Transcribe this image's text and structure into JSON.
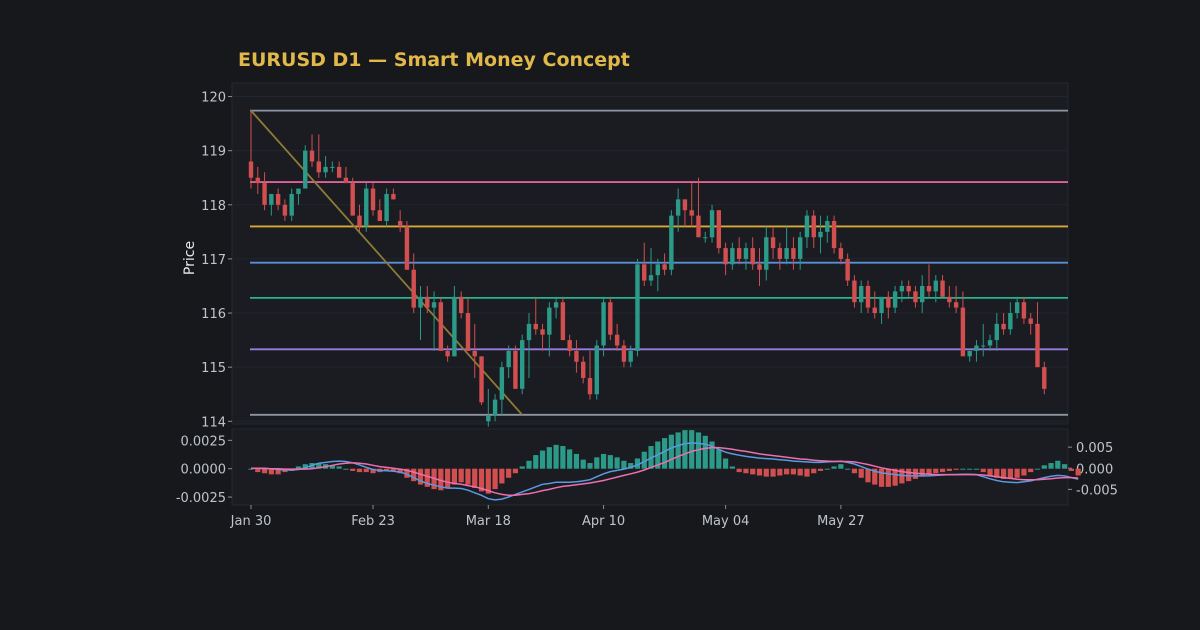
{
  "chart_data": {
    "type": "candlestick",
    "title": "EURUSD D1 — Smart Money Concept",
    "ylabel": "Price",
    "colors": {
      "background": "#17181c",
      "panel": "#1a1c22",
      "bull": "#2b9a88",
      "bear": "#d24f50",
      "macd_line": "#5a9ae0",
      "signal_line": "#ee6fae",
      "trend_line": "#8f7a36"
    },
    "price_panel": {
      "ylim": [
        113.95,
        120.25
      ],
      "yticks": [
        "114",
        "115",
        "116",
        "117",
        "118",
        "119",
        "120"
      ],
      "levels": [
        {
          "value": 119.74,
          "color": "#8e96a1"
        },
        {
          "value": 118.42,
          "color": "#e0629a"
        },
        {
          "value": 117.6,
          "color": "#d9a93a"
        },
        {
          "value": 116.93,
          "color": "#5a8fd6"
        },
        {
          "value": 116.28,
          "color": "#26b58c"
        },
        {
          "value": 115.33,
          "color": "#9a7de0"
        },
        {
          "value": 114.12,
          "color": "#8e96a1"
        }
      ],
      "trendline": {
        "from": {
          "index": 0,
          "price": 119.74
        },
        "to": {
          "index": 40,
          "price": 114.12
        }
      }
    },
    "macd_panel": {
      "left_ylim": [
        -0.0032,
        0.0035
      ],
      "left_ticks": [
        "0.0025",
        "0.0000",
        "-0.0025"
      ],
      "right_ylim": [
        -0.0087,
        0.0093
      ],
      "right_ticks": [
        "0.005",
        "0.000",
        "-0.005"
      ]
    },
    "x_ticks": [
      {
        "label": "Jan 30",
        "index": 0
      },
      {
        "label": "Feb 23",
        "index": 18
      },
      {
        "label": "Mar 18",
        "index": 35
      },
      {
        "label": "Apr 10",
        "index": 52
      },
      {
        "label": "May 04",
        "index": 70
      },
      {
        "label": "May 27",
        "index": 87
      }
    ],
    "candles": [
      [
        118.8,
        119.75,
        118.3,
        118.5
      ],
      [
        118.5,
        118.7,
        118.2,
        118.4
      ],
      [
        118.4,
        118.6,
        117.9,
        118.0
      ],
      [
        118.0,
        118.2,
        117.8,
        118.2
      ],
      [
        118.2,
        118.3,
        117.9,
        118.0
      ],
      [
        118.0,
        118.1,
        117.7,
        117.8
      ],
      [
        117.8,
        118.3,
        117.7,
        118.2
      ],
      [
        118.2,
        118.3,
        118.0,
        118.3
      ],
      [
        118.3,
        119.1,
        118.3,
        119.0
      ],
      [
        119.0,
        119.3,
        118.7,
        118.8
      ],
      [
        118.8,
        119.3,
        118.5,
        118.6
      ],
      [
        118.6,
        118.9,
        118.5,
        118.7
      ],
      [
        118.7,
        118.8,
        118.6,
        118.7
      ],
      [
        118.7,
        118.8,
        118.5,
        118.5
      ],
      [
        118.5,
        118.7,
        118.4,
        118.4
      ],
      [
        118.4,
        118.5,
        117.8,
        117.8
      ],
      [
        117.8,
        118.0,
        117.5,
        117.6
      ],
      [
        117.6,
        118.4,
        117.5,
        118.3
      ],
      [
        118.3,
        118.4,
        117.8,
        117.9
      ],
      [
        117.9,
        118.1,
        117.7,
        117.7
      ],
      [
        117.7,
        118.3,
        117.6,
        118.2
      ],
      [
        118.2,
        118.3,
        118.1,
        118.1
      ],
      [
        117.7,
        117.9,
        117.5,
        117.6
      ],
      [
        117.6,
        117.7,
        116.8,
        116.8
      ],
      [
        116.8,
        117.1,
        116.0,
        116.1
      ],
      [
        116.1,
        116.5,
        115.5,
        116.3
      ],
      [
        116.3,
        116.5,
        116.0,
        116.1
      ],
      [
        116.1,
        116.4,
        115.3,
        116.2
      ],
      [
        116.2,
        116.3,
        115.4,
        115.3
      ],
      [
        115.3,
        115.4,
        115.1,
        115.2
      ],
      [
        115.2,
        116.5,
        115.2,
        116.3
      ],
      [
        116.3,
        116.4,
        115.9,
        116.0
      ],
      [
        116.0,
        116.3,
        115.3,
        115.3
      ],
      [
        115.3,
        115.8,
        114.8,
        115.2
      ],
      [
        115.2,
        115.2,
        114.3,
        114.35
      ],
      [
        114.0,
        114.6,
        113.9,
        114.1
      ],
      [
        114.1,
        114.5,
        114.0,
        114.4
      ],
      [
        114.4,
        115.1,
        114.1,
        115.0
      ],
      [
        115.0,
        115.4,
        114.8,
        115.3
      ],
      [
        115.3,
        115.4,
        114.6,
        114.6
      ],
      [
        114.6,
        115.6,
        114.5,
        115.5
      ],
      [
        115.5,
        116.0,
        114.8,
        115.8
      ],
      [
        115.8,
        116.3,
        115.6,
        115.7
      ],
      [
        115.7,
        115.8,
        115.3,
        115.6
      ],
      [
        115.6,
        116.2,
        115.2,
        116.1
      ],
      [
        116.1,
        116.3,
        115.9,
        116.2
      ],
      [
        116.2,
        116.3,
        115.6,
        115.5
      ],
      [
        115.5,
        115.6,
        115.2,
        115.3
      ],
      [
        115.3,
        115.5,
        114.9,
        115.1
      ],
      [
        115.1,
        115.2,
        114.7,
        114.8
      ],
      [
        114.8,
        115.3,
        114.4,
        114.5
      ],
      [
        114.5,
        115.5,
        114.4,
        115.4
      ],
      [
        115.4,
        116.3,
        115.2,
        116.2
      ],
      [
        116.2,
        116.3,
        115.5,
        115.6
      ],
      [
        115.6,
        115.8,
        115.3,
        115.4
      ],
      [
        115.4,
        115.5,
        115.0,
        115.1
      ],
      [
        115.1,
        115.4,
        115.0,
        115.3
      ],
      [
        115.3,
        117.0,
        115.2,
        116.9
      ],
      [
        116.9,
        117.3,
        116.5,
        116.6
      ],
      [
        116.6,
        117.2,
        116.5,
        116.7
      ],
      [
        116.7,
        117.0,
        116.4,
        116.9
      ],
      [
        116.9,
        117.1,
        116.7,
        116.8
      ],
      [
        116.8,
        117.9,
        116.7,
        117.8
      ],
      [
        117.8,
        118.3,
        117.5,
        118.1
      ],
      [
        118.1,
        118.1,
        117.6,
        117.9
      ],
      [
        117.9,
        118.4,
        117.6,
        117.8
      ],
      [
        117.8,
        118.5,
        117.4,
        117.4
      ],
      [
        117.4,
        117.5,
        117.3,
        117.4
      ],
      [
        117.4,
        118.0,
        117.3,
        117.9
      ],
      [
        117.9,
        117.9,
        117.1,
        117.2
      ],
      [
        117.2,
        117.3,
        116.7,
        116.9
      ],
      [
        116.9,
        117.3,
        116.8,
        117.2
      ],
      [
        117.2,
        117.4,
        116.9,
        117.0
      ],
      [
        117.0,
        117.3,
        116.8,
        117.2
      ],
      [
        117.2,
        117.4,
        116.8,
        116.9
      ],
      [
        116.9,
        117.2,
        116.5,
        116.8
      ],
      [
        116.8,
        117.6,
        116.6,
        117.4
      ],
      [
        117.4,
        117.6,
        117.0,
        117.2
      ],
      [
        117.2,
        117.3,
        116.8,
        117.0
      ],
      [
        117.0,
        117.6,
        116.9,
        117.2
      ],
      [
        117.2,
        117.4,
        116.8,
        117.0
      ],
      [
        117.0,
        117.5,
        116.8,
        117.4
      ],
      [
        117.4,
        117.9,
        117.2,
        117.8
      ],
      [
        117.8,
        117.9,
        117.2,
        117.4
      ],
      [
        117.4,
        117.8,
        117.1,
        117.5
      ],
      [
        117.5,
        117.8,
        117.3,
        117.7
      ],
      [
        117.7,
        117.8,
        117.1,
        117.2
      ],
      [
        117.2,
        117.3,
        116.9,
        117.0
      ],
      [
        117.0,
        117.1,
        116.5,
        116.6
      ],
      [
        116.6,
        116.7,
        116.1,
        116.2
      ],
      [
        116.2,
        116.6,
        116.0,
        116.5
      ],
      [
        116.5,
        116.6,
        116.0,
        116.1
      ],
      [
        116.1,
        116.4,
        115.9,
        116.0
      ],
      [
        116.0,
        116.1,
        115.8,
        116.3
      ],
      [
        116.3,
        116.4,
        115.9,
        116.1
      ],
      [
        116.1,
        116.5,
        116.0,
        116.4
      ],
      [
        116.4,
        116.6,
        116.2,
        116.5
      ],
      [
        116.5,
        116.6,
        116.3,
        116.4
      ],
      [
        116.4,
        116.5,
        116.1,
        116.2
      ],
      [
        116.2,
        116.7,
        116.0,
        116.5
      ],
      [
        116.5,
        116.9,
        116.3,
        116.4
      ],
      [
        116.4,
        116.7,
        116.2,
        116.6
      ],
      [
        116.6,
        116.7,
        116.3,
        116.3
      ],
      [
        116.3,
        116.5,
        116.1,
        116.2
      ],
      [
        116.2,
        116.5,
        116.0,
        116.1
      ],
      [
        116.1,
        116.4,
        115.3,
        115.2
      ],
      [
        115.2,
        115.3,
        115.1,
        115.3
      ],
      [
        115.3,
        115.5,
        115.1,
        115.4
      ],
      [
        115.4,
        115.8,
        115.2,
        115.4
      ],
      [
        115.4,
        115.6,
        115.3,
        115.5
      ],
      [
        115.5,
        116.0,
        115.3,
        115.8
      ],
      [
        115.8,
        116.0,
        115.6,
        115.7
      ],
      [
        115.7,
        116.2,
        115.6,
        116.0
      ],
      [
        116.0,
        116.3,
        115.9,
        116.2
      ],
      [
        116.2,
        116.3,
        115.8,
        115.9
      ],
      [
        115.9,
        116.0,
        115.6,
        115.8
      ],
      [
        115.8,
        116.2,
        115.0,
        115.0
      ],
      [
        115.0,
        115.1,
        114.5,
        114.6
      ]
    ],
    "macd_hist": [
      0.0,
      -0.0003,
      -0.0004,
      -0.0005,
      -0.0005,
      -0.0003,
      -0.0002,
      0.0002,
      0.0004,
      0.0005,
      0.0005,
      0.0004,
      0.0003,
      0.0002,
      0.0,
      -0.0002,
      -0.0003,
      -0.0003,
      -0.0004,
      -0.0003,
      -0.0002,
      -0.0002,
      -0.0004,
      -0.0008,
      -0.0011,
      -0.0014,
      -0.0016,
      -0.0018,
      -0.0019,
      -0.0017,
      -0.0014,
      -0.0012,
      -0.0014,
      -0.0017,
      -0.002,
      -0.0022,
      -0.0018,
      -0.0013,
      -0.0008,
      -0.0004,
      0.0002,
      0.0007,
      0.0012,
      0.0016,
      0.0019,
      0.0021,
      0.002,
      0.0017,
      0.0013,
      0.0008,
      0.0005,
      0.001,
      0.0013,
      0.0012,
      0.001,
      0.0007,
      0.0005,
      0.0009,
      0.0015,
      0.002,
      0.0024,
      0.0027,
      0.003,
      0.0032,
      0.0034,
      0.0034,
      0.0032,
      0.0029,
      0.0024,
      0.0017,
      0.0009,
      0.0002,
      -0.0003,
      -0.0004,
      -0.0005,
      -0.0006,
      -0.0007,
      -0.0007,
      -0.0006,
      -0.0005,
      -0.0005,
      -0.0006,
      -0.0007,
      -0.0004,
      -0.0002,
      0.0,
      0.0002,
      0.0004,
      0.0,
      -0.0004,
      -0.0008,
      -0.0012,
      -0.0014,
      -0.0016,
      -0.0016,
      -0.0015,
      -0.0013,
      -0.0011,
      -0.0009,
      -0.0007,
      -0.0005,
      -0.0004,
      -0.0003,
      -0.0002,
      -0.0001,
      0.0,
      0.0,
      0.0,
      -0.0003,
      -0.0006,
      -0.0008,
      -0.0009,
      -0.0009,
      -0.0008,
      -0.0006,
      -0.0003,
      0.0,
      0.0003,
      0.0005,
      0.0007,
      0.0004,
      -0.0002,
      -0.0006
    ],
    "macd_line": [
      0.0,
      0.0,
      -0.0001,
      -0.0001,
      -0.0003,
      -0.0004,
      -0.0004,
      -0.0003,
      0.0001,
      0.0007,
      0.0012,
      0.0014,
      0.0016,
      0.0017,
      0.0016,
      0.0013,
      0.0008,
      0.0002,
      -0.0003,
      -0.0005,
      -0.0006,
      -0.0007,
      -0.0009,
      -0.0014,
      -0.0022,
      -0.003,
      -0.0036,
      -0.004,
      -0.0044,
      -0.0047,
      -0.0047,
      -0.0048,
      -0.0052,
      -0.0058,
      -0.0064,
      -0.0072,
      -0.0075,
      -0.0073,
      -0.0068,
      -0.0062,
      -0.0056,
      -0.005,
      -0.0044,
      -0.0038,
      -0.0036,
      -0.0033,
      -0.0033,
      -0.0033,
      -0.0032,
      -0.003,
      -0.0027,
      -0.002,
      -0.0013,
      -0.0008,
      -0.0005,
      -0.0002,
      0.0002,
      0.0008,
      0.0016,
      0.0024,
      0.0032,
      0.004,
      0.0048,
      0.0054,
      0.0058,
      0.006,
      0.0059,
      0.0057,
      0.0052,
      0.0045,
      0.0038,
      0.0034,
      0.0031,
      0.0028,
      0.0026,
      0.0024,
      0.0023,
      0.0022,
      0.002,
      0.0019,
      0.0017,
      0.0016,
      0.0015,
      0.0014,
      0.0014,
      0.0015,
      0.0016,
      0.0017,
      0.0014,
      0.001,
      0.0004,
      -0.0002,
      -0.0007,
      -0.0011,
      -0.0013,
      -0.0015,
      -0.0017,
      -0.0018,
      -0.0018,
      -0.0018,
      -0.0018,
      -0.0017,
      -0.0016,
      -0.0015,
      -0.0015,
      -0.0014,
      -0.0014,
      -0.0015,
      -0.002,
      -0.0025,
      -0.0029,
      -0.0032,
      -0.0033,
      -0.0034,
      -0.0032,
      -0.003,
      -0.0026,
      -0.0022,
      -0.0019,
      -0.0017,
      -0.0018,
      -0.0022,
      -0.0026
    ],
    "signal_line": [
      0.0,
      0.0,
      0.0,
      -0.0001,
      -0.0001,
      -0.0002,
      -0.0002,
      -0.0002,
      -0.0002,
      -0.0001,
      0.0001,
      0.0004,
      0.0007,
      0.001,
      0.0012,
      0.0013,
      0.0012,
      0.001,
      0.0007,
      0.0004,
      0.0002,
      0.0,
      -0.0002,
      -0.0005,
      -0.0009,
      -0.0014,
      -0.0019,
      -0.0024,
      -0.0029,
      -0.0033,
      -0.0036,
      -0.0038,
      -0.0041,
      -0.0044,
      -0.0048,
      -0.0053,
      -0.0058,
      -0.0062,
      -0.0064,
      -0.0064,
      -0.0062,
      -0.006,
      -0.0057,
      -0.0053,
      -0.005,
      -0.0046,
      -0.0043,
      -0.0041,
      -0.0039,
      -0.0037,
      -0.0035,
      -0.0032,
      -0.0029,
      -0.0025,
      -0.0021,
      -0.0017,
      -0.0013,
      -0.0009,
      -0.0004,
      0.0002,
      0.0008,
      0.0014,
      0.0021,
      0.0028,
      0.0034,
      0.004,
      0.0044,
      0.0047,
      0.0049,
      0.0049,
      0.0047,
      0.0045,
      0.0042,
      0.004,
      0.0037,
      0.0034,
      0.0032,
      0.003,
      0.0028,
      0.0026,
      0.0024,
      0.0022,
      0.0021,
      0.0019,
      0.0018,
      0.0017,
      0.0016,
      0.0016,
      0.0016,
      0.0015,
      0.0012,
      0.0009,
      0.0005,
      0.0001,
      -0.0002,
      -0.0005,
      -0.0008,
      -0.001,
      -0.0012,
      -0.0013,
      -0.0014,
      -0.0015,
      -0.0015,
      -0.0015,
      -0.0015,
      -0.0015,
      -0.0015,
      -0.0015,
      -0.0016,
      -0.0018,
      -0.002,
      -0.0022,
      -0.0024,
      -0.0026,
      -0.0027,
      -0.0027,
      -0.0027,
      -0.0026,
      -0.0025,
      -0.0023,
      -0.0022,
      -0.0022,
      -0.0023
    ]
  }
}
